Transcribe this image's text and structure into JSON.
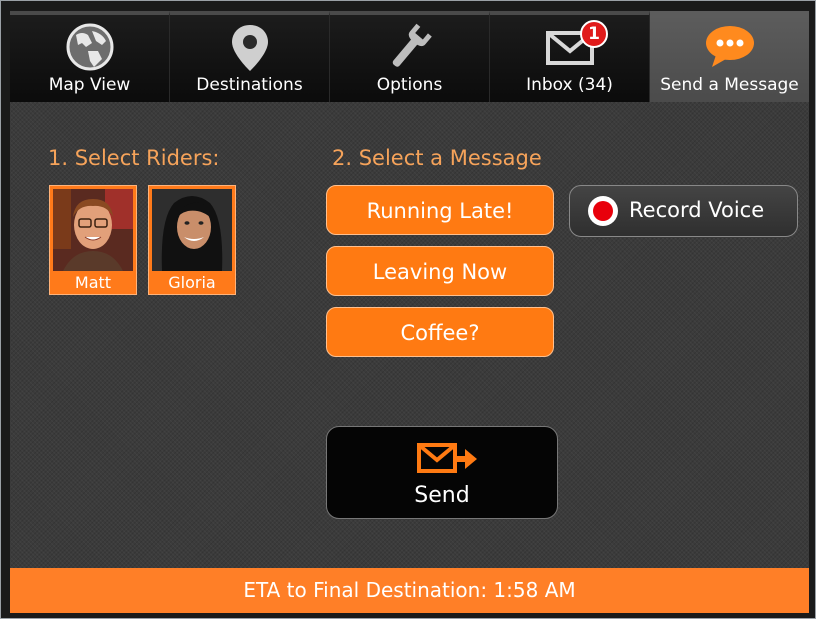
{
  "tabs": [
    {
      "label": "Map View",
      "icon": "globe-icon"
    },
    {
      "label": "Destinations",
      "icon": "map-pin-icon"
    },
    {
      "label": "Options",
      "icon": "wrench-icon"
    },
    {
      "label": "Inbox (34)",
      "icon": "envelope-icon",
      "badge": "1"
    },
    {
      "label": "Send a Message",
      "icon": "chat-bubble-icon",
      "active": true
    }
  ],
  "riders_heading": "1. Select Riders:",
  "riders": [
    {
      "name": "Matt"
    },
    {
      "name": "Gloria"
    }
  ],
  "message_heading": "2. Select a Message",
  "messages": [
    "Running Late!",
    "Leaving Now",
    "Coffee?"
  ],
  "record_voice_label": "Record Voice",
  "send_label": "Send",
  "footer_text": "ETA to Final Destination: 1:58 AM",
  "colors": {
    "accent": "#ff7a12",
    "heading": "#f6a35a",
    "record": "#e8000b",
    "badge": "#e01b1b"
  }
}
